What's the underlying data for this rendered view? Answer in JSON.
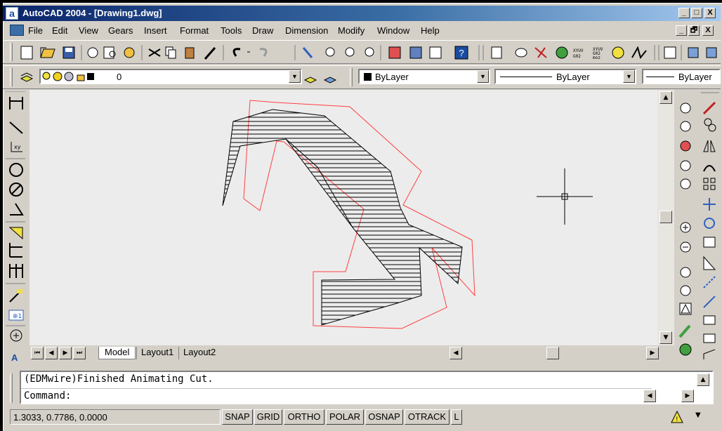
{
  "window": {
    "title": "AutoCAD 2004 - [Drawing1.dwg]",
    "app_icon": "a",
    "minimize": "_",
    "maximize": "□",
    "close": "X",
    "doc_minimize": "_",
    "doc_restore": "🗗",
    "doc_close": "X"
  },
  "menu": [
    "File",
    "Edit",
    "View",
    "Gears",
    "Insert",
    "Format",
    "Tools",
    "Draw",
    "Dimension",
    "Modify",
    "Window",
    "Help"
  ],
  "layers": {
    "layer_name": "0",
    "color_value": "ByLayer",
    "linetype_value": "ByLayer",
    "lineweight_value": "ByLayer"
  },
  "tabs": [
    "Model",
    "Layout1",
    "Layout2"
  ],
  "command": {
    "history": "(EDMwire)Finished Animating Cut.",
    "prompt": "Command:"
  },
  "status": {
    "coords": "1.3033, 0.7786, 0.0000",
    "buttons": [
      "SNAP",
      "GRID",
      "ORTHO",
      "POLAR",
      "OSNAP",
      "OTRACK",
      "L"
    ]
  },
  "colors": {
    "title_start": "#0a246a",
    "canvas_bg": "#ececec",
    "offset_path": "#ff4040",
    "hatch": "#000000"
  }
}
